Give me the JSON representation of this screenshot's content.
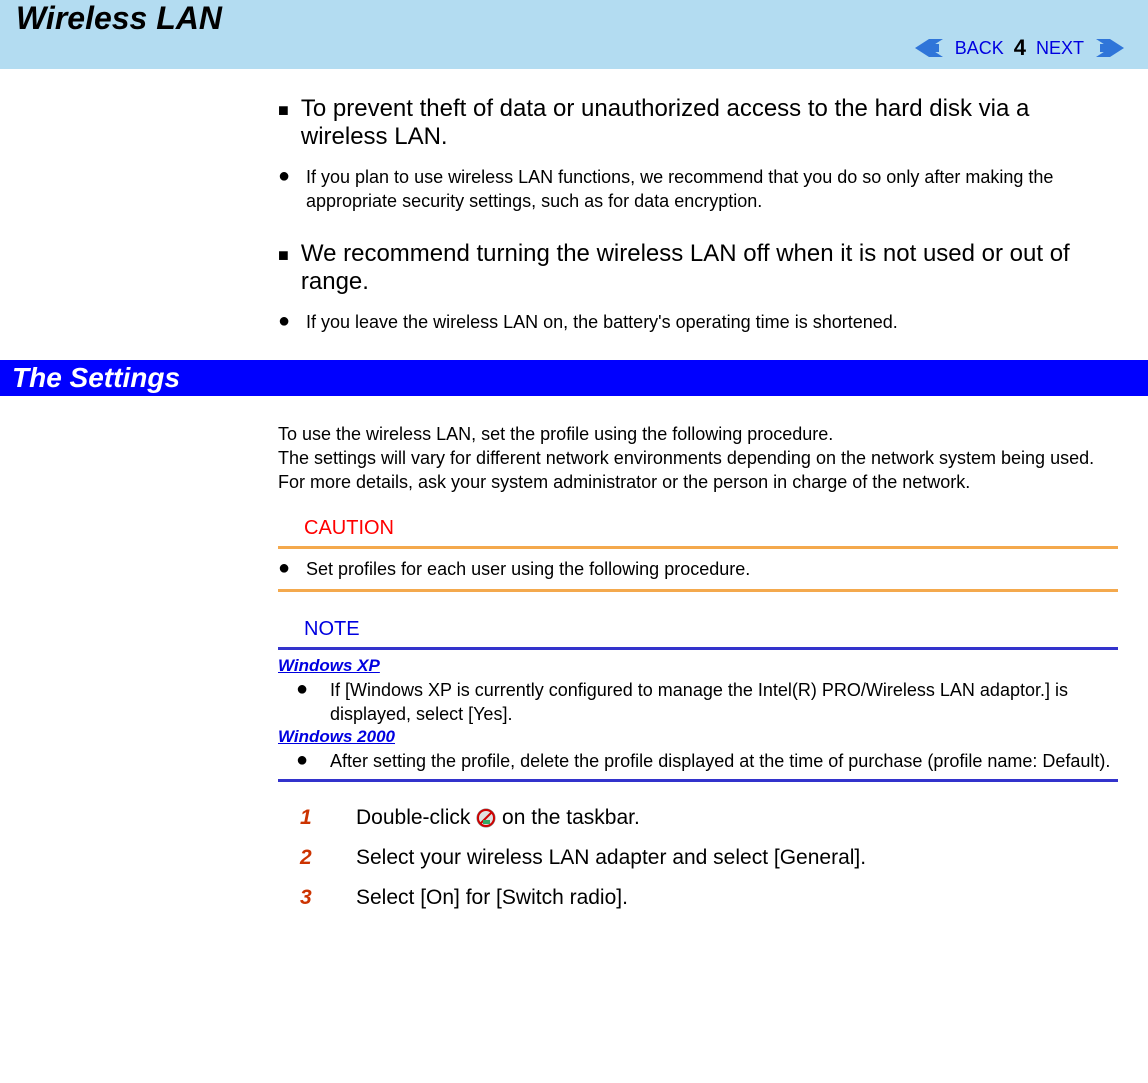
{
  "header": {
    "title": "Wireless LAN",
    "back_label": "BACK",
    "next_label": "NEXT",
    "page_number": "4"
  },
  "top": {
    "heading1": "To prevent theft of data or unauthorized access to the hard disk via a wireless LAN.",
    "bullet1": "If you plan to use wireless LAN functions, we recommend that you do so only after making the appropriate security settings, such as for data encryption.",
    "heading2": "We recommend turning the wireless LAN off when it is not used or out of range.",
    "bullet2": "If you leave the wireless LAN on, the battery's operating time is shortened."
  },
  "section_title": "The Settings",
  "intro_para": "To use the wireless LAN, set the profile using the following procedure.\nThe settings will vary for different network environments depending on the network system being used. For more details, ask your system administrator or the person in charge of the network.",
  "caution": {
    "label": "CAUTION",
    "bullet": "Set profiles for each user using the following procedure."
  },
  "note": {
    "label": "NOTE",
    "os1_label": "Windows XP",
    "os1_bullet": "If [Windows XP is currently configured to manage the Intel(R) PRO/Wireless LAN adaptor.] is displayed, select [Yes].",
    "os2_label": "Windows 2000",
    "os2_bullet": "After setting the profile, delete the profile displayed at the time of purchase (profile name: Default)."
  },
  "steps": [
    {
      "num": "1",
      "before": "Double-click ",
      "after": " on the taskbar.",
      "has_icon": true
    },
    {
      "num": "2",
      "text": "Select your wireless LAN adapter and select [General]."
    },
    {
      "num": "3",
      "text": "Select [On] for [Switch radio]."
    }
  ]
}
